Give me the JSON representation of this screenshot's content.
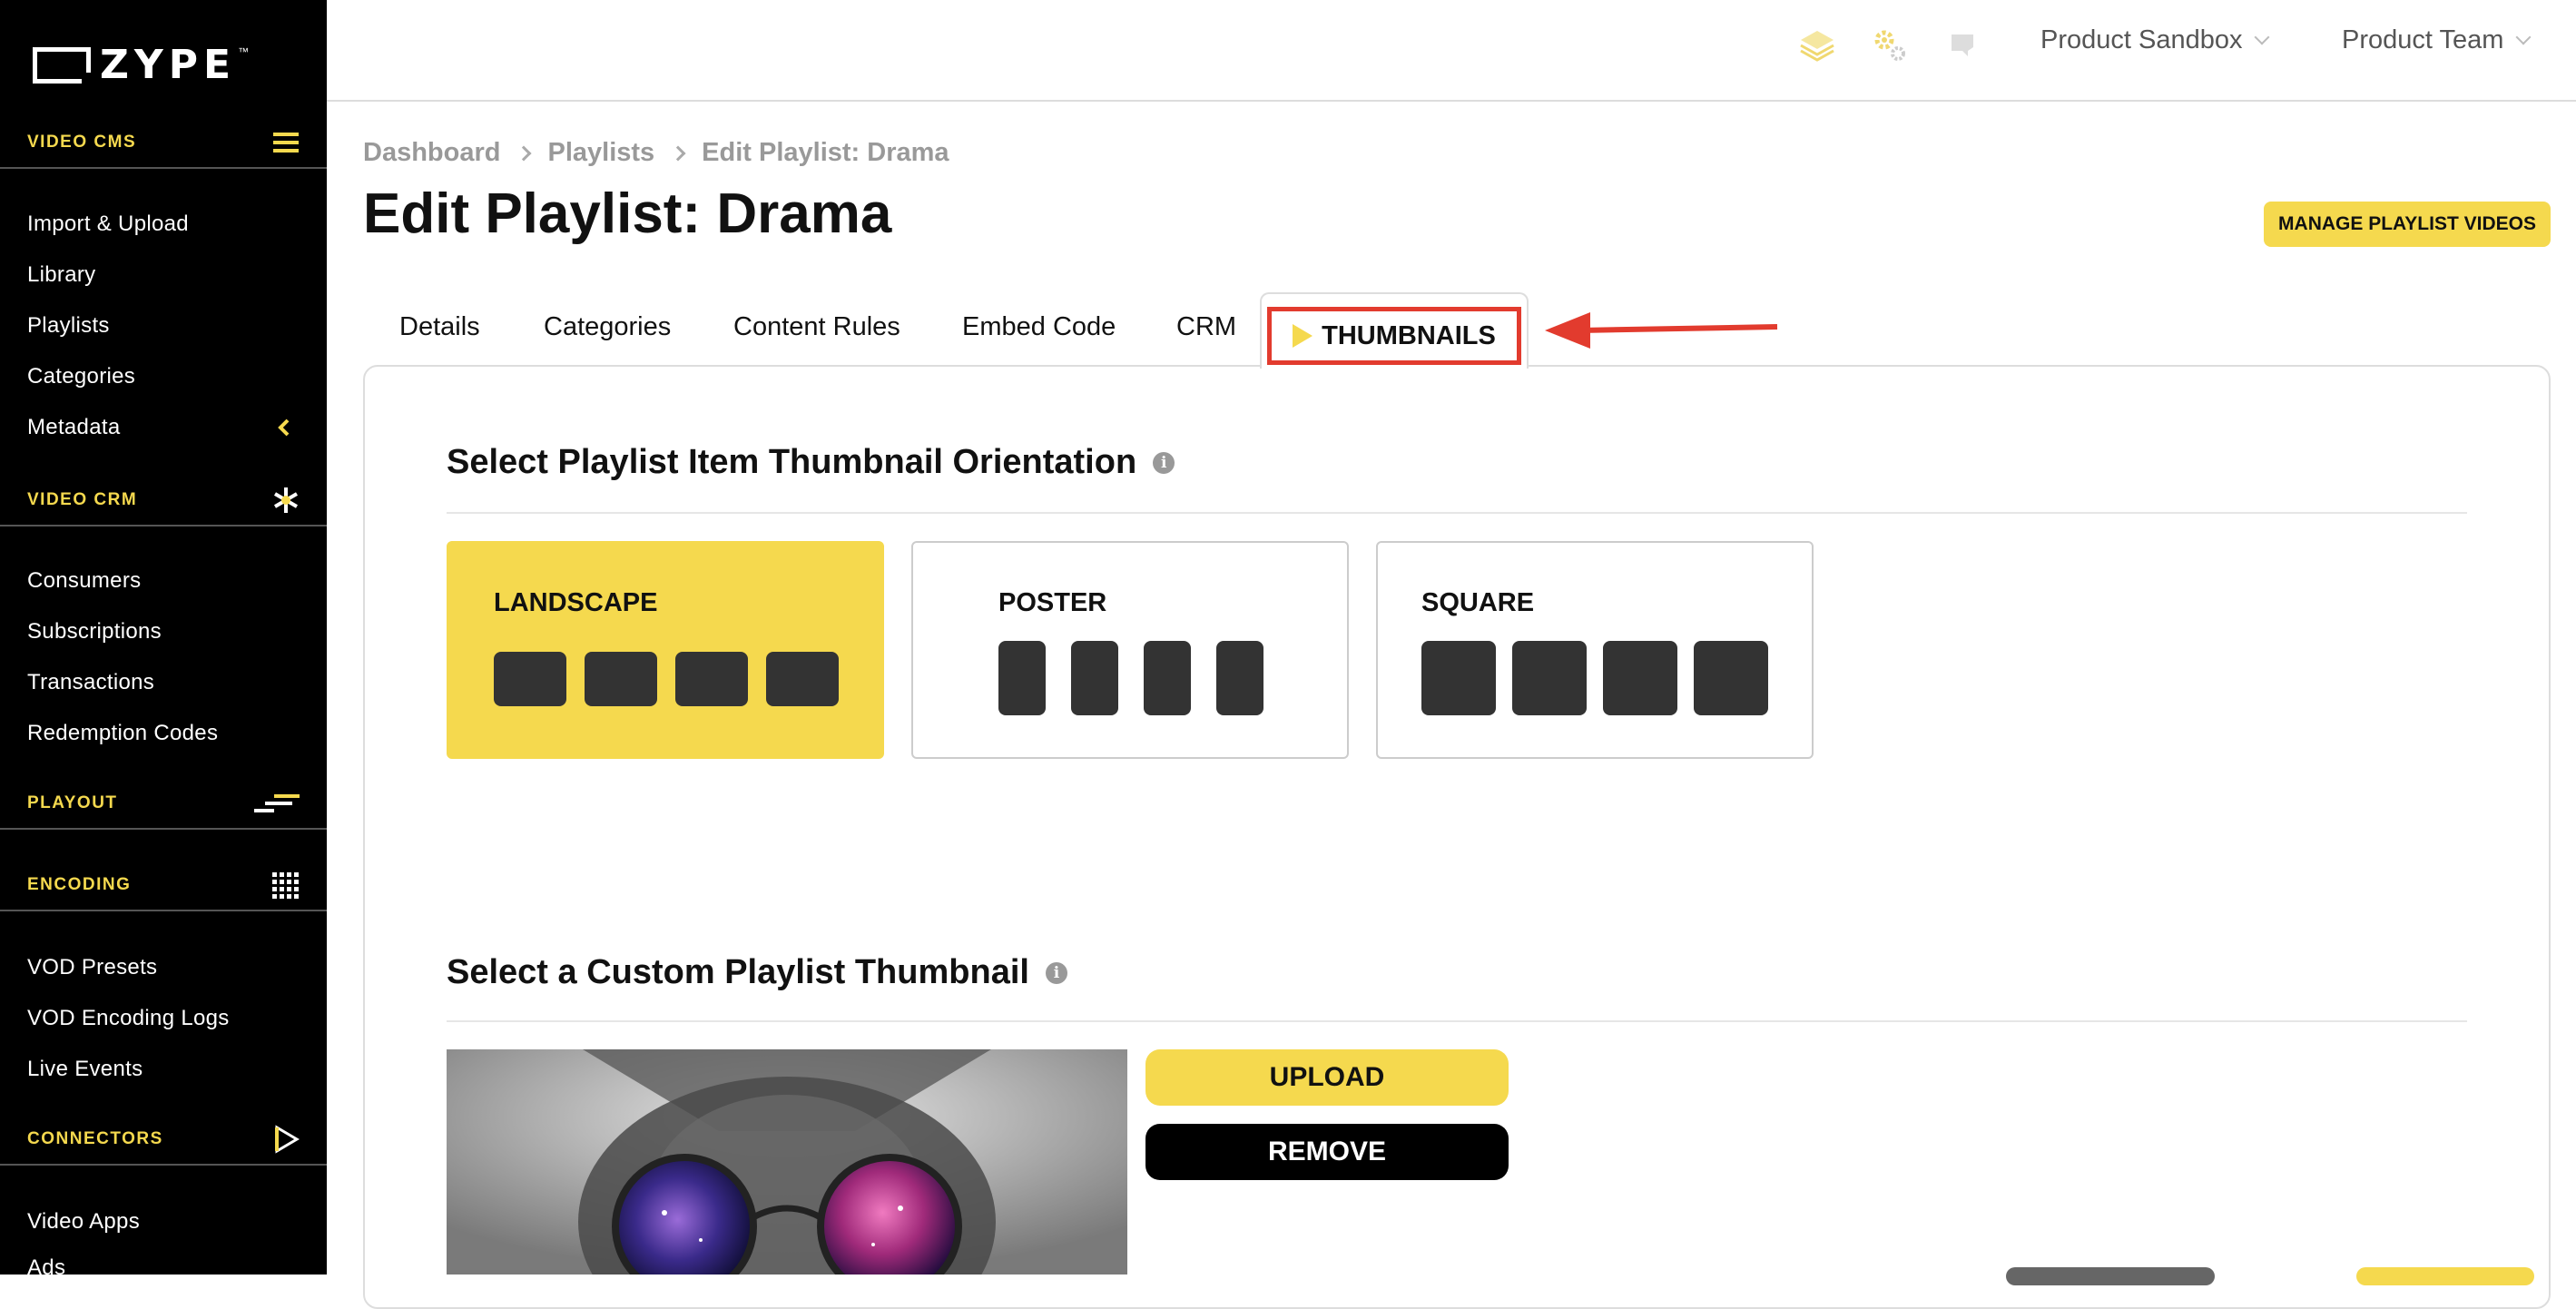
{
  "app": {
    "logo_text": "ZYPE",
    "logo_tm": "™"
  },
  "sidebar": {
    "sections": [
      {
        "label": "VIDEO CMS",
        "icon": "hamburger-icon",
        "items": [
          "Import & Upload",
          "Library",
          "Playlists",
          "Categories",
          "Metadata"
        ]
      },
      {
        "label": "VIDEO CRM",
        "icon": "asterisk-icon",
        "items": [
          "Consumers",
          "Subscriptions",
          "Transactions",
          "Redemption Codes"
        ]
      },
      {
        "label": "PLAYOUT",
        "icon": "playout-lines-icon",
        "items": []
      },
      {
        "label": "ENCODING",
        "icon": "grid-dots-icon",
        "items": [
          "VOD Presets",
          "VOD Encoding Logs",
          "Live Events"
        ]
      },
      {
        "label": "CONNECTORS",
        "icon": "play-outline-icon",
        "items": [
          "Video Apps",
          "Ads"
        ]
      }
    ]
  },
  "topbar": {
    "icons": [
      "layers-icon",
      "gears-icon",
      "ticket-icon"
    ],
    "site_dropdown": "Product Sandbox",
    "team_dropdown": "Product Team"
  },
  "breadcrumb": [
    "Dashboard",
    "Playlists",
    "Edit Playlist: Drama"
  ],
  "page_title": "Edit Playlist: Drama",
  "manage_button": "MANAGE PLAYLIST VIDEOS",
  "tabs": [
    "Details",
    "Categories",
    "Content Rules",
    "Embed Code",
    "CRM",
    "THUMBNAILS"
  ],
  "active_tab": "THUMBNAILS",
  "orientation": {
    "heading": "Select Playlist Item Thumbnail Orientation",
    "options": [
      "LANDSCAPE",
      "POSTER",
      "SQUARE"
    ],
    "selected": "LANDSCAPE"
  },
  "custom": {
    "heading": "Select a Custom Playlist Thumbnail",
    "upload_label": "UPLOAD",
    "remove_label": "REMOVE"
  },
  "colors": {
    "accent": "#f5d94e",
    "highlight": "#e23b2e",
    "sidebar_bg": "#000000"
  }
}
